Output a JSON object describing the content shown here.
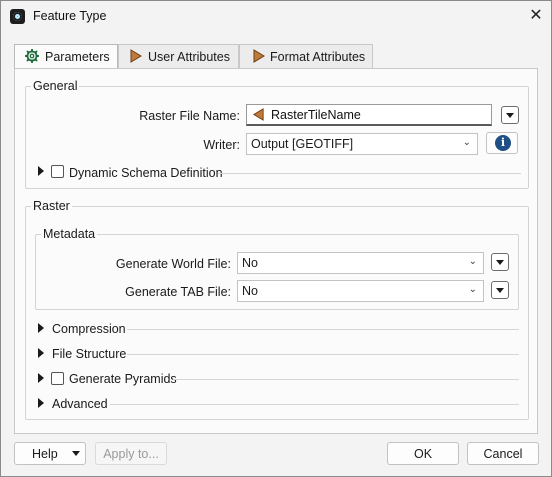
{
  "window": {
    "title": "Feature Type",
    "close_glyph": "✕",
    "app_icon": "fme-app-icon"
  },
  "tabs": [
    {
      "label": "Parameters",
      "icon": "gear-icon",
      "active": true
    },
    {
      "label": "User Attributes",
      "icon": "attribute-arrow-icon",
      "active": false
    },
    {
      "label": "Format Attributes",
      "icon": "attribute-arrow-icon",
      "active": false
    }
  ],
  "general": {
    "title": "General",
    "raster_file_name": {
      "label": "Raster File Name:",
      "value": "RasterTileName"
    },
    "writer": {
      "label": "Writer:",
      "value": "Output [GEOTIFF]"
    },
    "dynamic_schema": {
      "label": "Dynamic Schema Definition",
      "checked": false
    }
  },
  "raster": {
    "title": "Raster",
    "metadata": {
      "title": "Metadata",
      "generate_world_file": {
        "label": "Generate World File:",
        "value": "No"
      },
      "generate_tab_file": {
        "label": "Generate TAB File:",
        "value": "No"
      }
    },
    "sections": {
      "compression": "Compression",
      "file_structure": "File Structure",
      "generate_pyramids": "Generate Pyramids",
      "advanced": "Advanced"
    }
  },
  "footer": {
    "help": "Help",
    "apply_to": "Apply to...",
    "ok": "OK",
    "cancel": "Cancel"
  },
  "colors": {
    "info_icon": "#1f4f84",
    "attr_arrow": "#9b5a22",
    "app_icon_accent": "#2fb4e8"
  }
}
